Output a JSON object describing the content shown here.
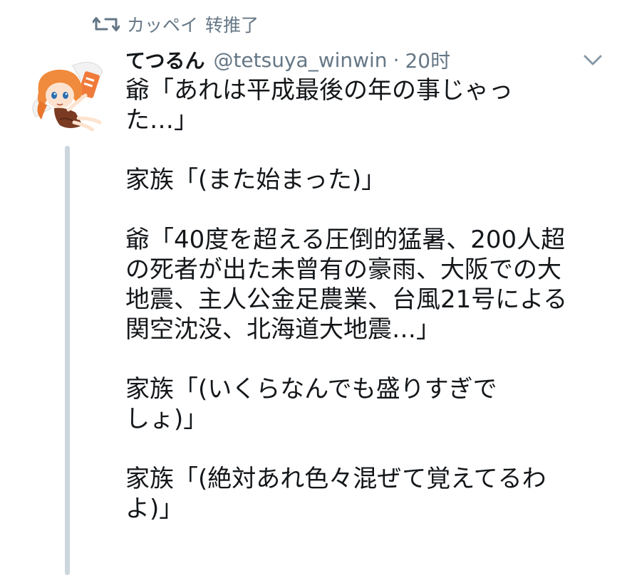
{
  "retweet": {
    "icon": "retweet-icon",
    "user": "カッペイ",
    "action": "转推了"
  },
  "tweet": {
    "avatar": "anime-character-avatar",
    "display_name": "てつるん",
    "handle": "@tetsuya_winwin",
    "separator": "·",
    "time": "20时",
    "menu_icon": "chevron-down-icon",
    "paragraphs": [
      {
        "lines": [
          "爺「あれは平成最後の年の事じゃっ",
          "た…」"
        ]
      },
      {
        "lines": [
          "家族「(また始まった)」"
        ]
      },
      {
        "lines": [
          "爺「40度を超える圧倒的猛暑、200人超",
          "の死者が出た未曾有の豪雨、大阪での大",
          "地震、主人公金足農業、台風21号による",
          "関空沈没、北海道大地震…」"
        ]
      },
      {
        "lines": [
          "家族「(いくらなんでも盛りすぎで",
          "しょ)」"
        ]
      },
      {
        "lines": [
          "家族「(絶対あれ色々混ぜて覚えてるわ",
          "よ)」"
        ]
      }
    ]
  },
  "colors": {
    "text": "#14171a",
    "secondary": "#657786",
    "thread_line": "#ccd6dd"
  }
}
